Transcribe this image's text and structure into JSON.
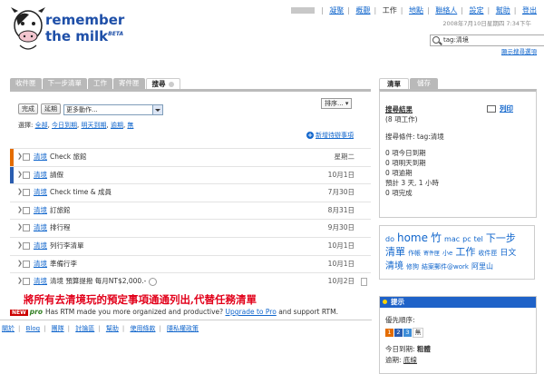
{
  "logo": {
    "line1": "remember",
    "line2": "the milk",
    "beta": "BETA"
  },
  "topnav": {
    "items": [
      "凝聚",
      "概觀",
      "工作",
      "地點",
      "聯絡人",
      "設定",
      "幫助",
      "登出"
    ],
    "datetime": "2008年7月10日星期四 7:34下午"
  },
  "search": {
    "value": "tag:清境",
    "advanced": "顯示搜尋選項"
  },
  "tabs": [
    "收件匣",
    "下一步清單",
    "工作",
    "寄件匣",
    "搜尋"
  ],
  "toolbar": {
    "complete": "完成",
    "postpone": "延期",
    "more_actions": "更多動作...",
    "sort": "排序..."
  },
  "select_row": {
    "label": "選擇:",
    "all": "全部",
    "today": "今日到期",
    "tomorrow": "明天到期",
    "overdue": "逾期",
    "none": "無"
  },
  "new_task": "新增待辦事項",
  "tasks": [
    {
      "tag": "清境",
      "name": "Check 旅館",
      "due": "星期二",
      "prio_color": "#e46c00"
    },
    {
      "tag": "清境",
      "name": "請假",
      "due": "10月1日",
      "prio_color": "#2a5db0"
    },
    {
      "tag": "清境",
      "name": "Check time & 成員",
      "due": "7月30日",
      "prio_color": ""
    },
    {
      "tag": "清境",
      "name": "訂旅館",
      "due": "8月31日",
      "prio_color": ""
    },
    {
      "tag": "清境",
      "name": "排行程",
      "due": "9月30日",
      "prio_color": ""
    },
    {
      "tag": "清境",
      "name": "列行李清單",
      "due": "10月1日",
      "prio_color": ""
    },
    {
      "tag": "清境",
      "name": "準備行李",
      "due": "10月1日",
      "prio_color": ""
    },
    {
      "tag": "清境",
      "name": "清境 預算提撥 每月NT$2,000.-",
      "due": "10月2日",
      "prio_color": ""
    }
  ],
  "annotation": "將所有去清境玩的預定事項通通列出,代替任務清單",
  "promo": {
    "new": "NEW",
    "pro": "pro",
    "text": "Has RTM made you more organized and productive?",
    "link": "Upgrade to Pro",
    "tail": "and support RTM."
  },
  "footer": [
    "關於",
    "Blog",
    "團隊",
    "討論區",
    "幫助",
    "使用條款",
    "隱私權政策"
  ],
  "right_tabs": [
    "清單",
    "儲存"
  ],
  "search_results": {
    "title": "搜尋結果",
    "count": "(8 項工作)",
    "print": "列印",
    "condition": "搜尋條件: tag:清境",
    "stats": [
      "0 項今日到期",
      "0 項明天到期",
      "0 項逾期",
      "預計 3 天, 1 小時",
      "0 項完成"
    ]
  },
  "tag_cloud": [
    {
      "t": "do",
      "s": 8
    },
    {
      "t": "home",
      "s": 12
    },
    {
      "t": "竹",
      "s": 12
    },
    {
      "t": "mac",
      "s": 8
    },
    {
      "t": "pc",
      "s": 8
    },
    {
      "t": "tel",
      "s": 8
    },
    {
      "t": "下一步",
      "s": 11
    },
    {
      "t": "清單",
      "s": 11
    },
    {
      "t": "作帳",
      "s": 7
    },
    {
      "t": "寄件匣",
      "s": 6
    },
    {
      "t": "小e",
      "s": 7
    },
    {
      "t": "工作",
      "s": 11
    },
    {
      "t": "收件匣",
      "s": 7
    },
    {
      "t": "日文",
      "s": 9
    },
    {
      "t": "清境",
      "s": 10
    },
    {
      "t": "修狗",
      "s": 7
    },
    {
      "t": "結案郵件@work",
      "s": 7
    },
    {
      "t": "阿里山",
      "s": 8
    }
  ],
  "tips": {
    "title": "提示",
    "priority_label": "優先順序:",
    "priorities": [
      {
        "n": "1",
        "c": "#e46c00"
      },
      {
        "n": "2",
        "c": "#2a5db0"
      },
      {
        "n": "3",
        "c": "#3d8dd8"
      },
      {
        "n": "無",
        "c": ""
      }
    ],
    "today_label": "今日到期:",
    "today_val": "粗體",
    "overdue_label": "逾期:",
    "overdue_val": "底線"
  }
}
